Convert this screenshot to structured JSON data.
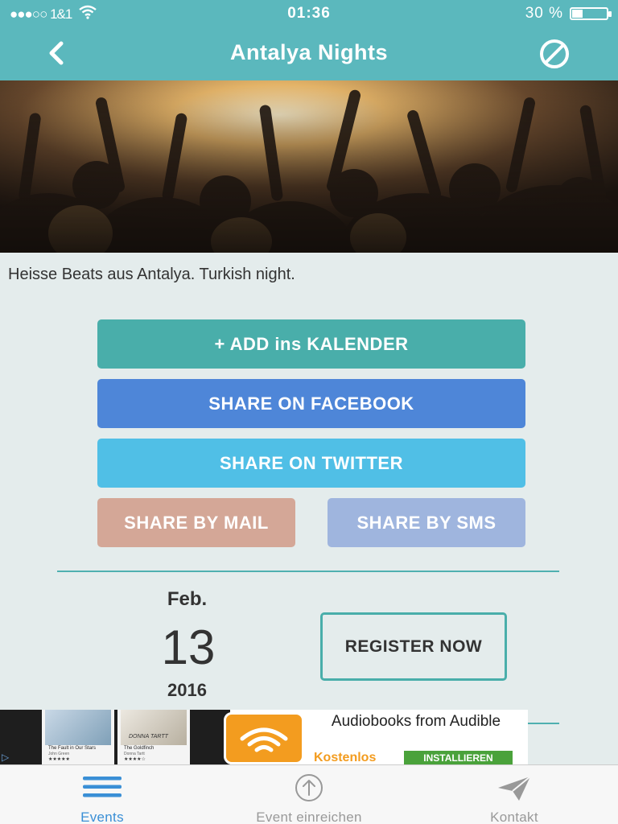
{
  "status_bar": {
    "carrier": "●●●○○ 1&1",
    "time": "01:36",
    "battery": "30 %",
    "battery_level": 0.3
  },
  "nav": {
    "title": "Antalya Nights",
    "back_icon": "chevron-left-icon",
    "action_icon": "block-icon"
  },
  "event": {
    "description": "Heisse Beats aus Antalya. Turkish night.",
    "date": {
      "month": "Feb.",
      "day": "13",
      "year": "2016"
    }
  },
  "actions": {
    "calendar": "+ ADD ins KALENDER",
    "facebook": "SHARE ON FACEBOOK",
    "twitter": "SHARE ON TWITTER",
    "mail": "SHARE BY MAIL",
    "sms": "SHARE BY SMS",
    "register": "REGISTER NOW"
  },
  "ad": {
    "headline": "Audiobooks from Audible",
    "free": "Kostenlos",
    "install": "INSTALLIEREN",
    "books": [
      {
        "title": "The Fault in Our Stars",
        "author": "John Green",
        "stars": "★★★★★"
      },
      {
        "title": "The Goldfinch",
        "author": "Donna Tartt",
        "stars": "★★★★☆"
      }
    ],
    "cover_text": "DONNA TARTT"
  },
  "tabs": [
    {
      "label": "Events",
      "icon": "menu-lines-icon",
      "active": true
    },
    {
      "label": "Event einreichen",
      "icon": "upload-circle-icon",
      "active": false
    },
    {
      "label": "Kontakt",
      "icon": "paper-plane-icon",
      "active": false
    }
  ],
  "colors": {
    "header": "#5bb8bd",
    "calendar_button": "#49aeaa",
    "facebook_button": "#4e86d8",
    "twitter_button": "#50bfe6",
    "mail_button": "#d4a797",
    "sms_button": "#9fb5de",
    "active_tab": "#3a8fd6"
  }
}
